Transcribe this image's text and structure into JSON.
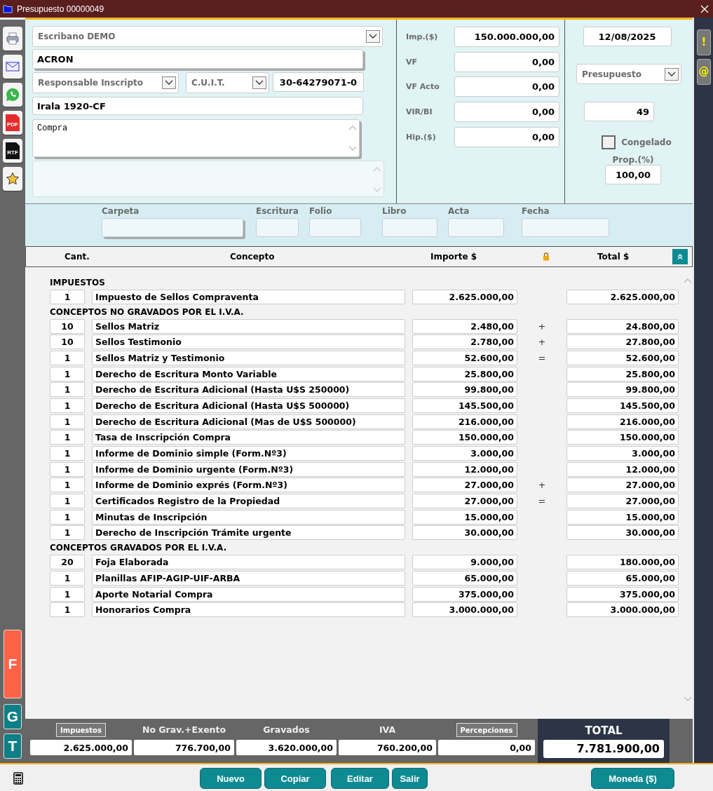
{
  "window": {
    "title": "Presupuesto 00000049"
  },
  "tools": [
    {
      "kind": "print"
    },
    {
      "kind": "mail"
    },
    {
      "kind": "whatsapp"
    },
    {
      "kind": "pdf",
      "label": "PDF"
    },
    {
      "kind": "rtf",
      "label": "RTF"
    },
    {
      "kind": "star"
    }
  ],
  "side_letters": [
    {
      "label": "F",
      "color": "#ff6347"
    },
    {
      "label": "G",
      "color": "#0e7f86"
    },
    {
      "label": "T",
      "color": "#0e7f86"
    }
  ],
  "right_buttons": [
    "!",
    "@"
  ],
  "client": {
    "escribano": "Escribano DEMO",
    "name": "ACRON",
    "iva": "Responsable Inscripto",
    "id_type": "C.U.I.T.",
    "id_number": "30-64279071-0",
    "address": "Irala 1920-CF",
    "note": "Compra"
  },
  "amounts": [
    {
      "label": "Imp.($)",
      "value": "150.000.000,00"
    },
    {
      "label": "VF",
      "value": "0,00"
    },
    {
      "label": "VF Acto",
      "value": "0,00"
    },
    {
      "label": "VIR/BI",
      "value": "0,00"
    },
    {
      "label": "Hip.($)",
      "value": "0,00"
    }
  ],
  "doc": {
    "date": "12/08/2025",
    "type": "Presupuesto",
    "number": "49",
    "frozen_label": "Congelado",
    "frozen": false,
    "prop_label": "Prop.(%)",
    "prop": "100,00"
  },
  "record_fields": [
    "Carpeta",
    "Escritura",
    "Folio",
    "Libro",
    "Acta",
    "Fecha"
  ],
  "columns": [
    "Cant.",
    "Concepto",
    "Importe $",
    "Total $"
  ],
  "sections": [
    {
      "title": "IMPUESTOS",
      "rows": [
        {
          "qty": "1",
          "concept": "Impuesto de Sellos Compraventa",
          "amount": "2.625.000,00",
          "total": "2.625.000,00"
        }
      ]
    },
    {
      "title": "CONCEPTOS NO GRAVADOS POR EL I.V.A.",
      "rows": [
        {
          "qty": "10",
          "concept": "Sellos Matriz",
          "amount": "2.480,00",
          "op": "+",
          "total": "24.800,00"
        },
        {
          "qty": "10",
          "concept": "Sellos Testimonio",
          "amount": "2.780,00",
          "op": "+",
          "total": "27.800,00"
        },
        {
          "qty": "1",
          "concept": "Sellos Matriz y Testimonio",
          "amount": "52.600,00",
          "op": "=",
          "total": "52.600,00"
        },
        {
          "qty": "1",
          "concept": "Derecho de Escritura Monto Variable",
          "amount": "25.800,00",
          "total": "25.800,00"
        },
        {
          "qty": "1",
          "concept": "Derecho de Escritura Adicional (Hasta U$S 250000)",
          "amount": "99.800,00",
          "total": "99.800,00"
        },
        {
          "qty": "1",
          "concept": "Derecho de Escritura Adicional (Hasta U$S 500000)",
          "amount": "145.500,00",
          "total": "145.500,00"
        },
        {
          "qty": "1",
          "concept": "Derecho de Escritura Adicional (Mas de U$S 500000)",
          "amount": "216.000,00",
          "total": "216.000,00"
        },
        {
          "qty": "1",
          "concept": "Tasa de Inscripción Compra",
          "amount": "150.000,00",
          "total": "150.000,00"
        },
        {
          "qty": "1",
          "concept": "Informe de Dominio simple (Form.Nº3)",
          "amount": "3.000,00",
          "total": "3.000,00"
        },
        {
          "qty": "1",
          "concept": "Informe de Dominio urgente (Form.Nº3)",
          "amount": "12.000,00",
          "total": "12.000,00"
        },
        {
          "qty": "1",
          "concept": "Informe de Dominio exprés (Form.Nº3)",
          "amount": "27.000,00",
          "op": "+",
          "total": "27.000,00"
        },
        {
          "qty": "1",
          "concept": "Certificados Registro de la Propiedad",
          "amount": "27.000,00",
          "op": "=",
          "total": "27.000,00"
        },
        {
          "qty": "1",
          "concept": "Minutas de Inscripción",
          "amount": "15.000,00",
          "total": "15.000,00"
        },
        {
          "qty": "1",
          "concept": "Derecho de Inscripción Trámite urgente",
          "amount": "30.000,00",
          "total": "30.000,00"
        }
      ]
    },
    {
      "title": "CONCEPTOS GRAVADOS POR EL I.V.A.",
      "rows": [
        {
          "qty": "20",
          "concept": "Foja Elaborada",
          "amount": "9.000,00",
          "total": "180.000,00"
        },
        {
          "qty": "1",
          "concept": "Planillas AFIP-AGIP-UIF-ARBA",
          "amount": "65.000,00",
          "total": "65.000,00"
        },
        {
          "qty": "1",
          "concept": "Aporte Notarial Compra",
          "amount": "375.000,00",
          "total": "375.000,00"
        },
        {
          "qty": "1",
          "concept": "Honorarios Compra",
          "amount": "3.000.000,00",
          "total": "3.000.000,00"
        }
      ]
    }
  ],
  "totals": [
    {
      "label": "Impuestos",
      "kind": "button",
      "value": "2.625.000,00"
    },
    {
      "label": "No Grav.+Exento",
      "kind": "text",
      "value": "776.700,00"
    },
    {
      "label": "Gravados",
      "kind": "text",
      "value": "3.620.000,00"
    },
    {
      "label": "IVA",
      "kind": "text",
      "value": "760.200,00"
    },
    {
      "label": "Percepciones",
      "kind": "button",
      "value": "0,00"
    }
  ],
  "grand_total": {
    "label": "TOTAL",
    "value": "7.781.900,00"
  },
  "buttons": [
    {
      "label": "Nuevo"
    },
    {
      "label": "Copiar"
    },
    {
      "label": "Editar"
    },
    {
      "label": "Salir"
    }
  ],
  "currency_button": "Moneda ($)"
}
